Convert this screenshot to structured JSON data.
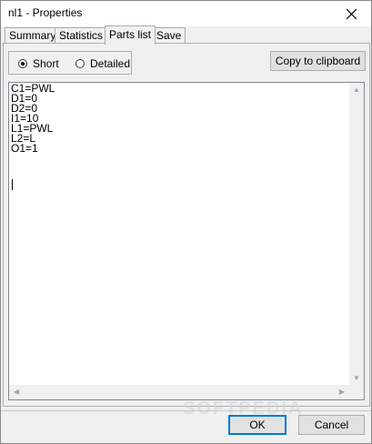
{
  "window": {
    "title": "nl1 - Properties"
  },
  "tabs": [
    {
      "label": "Summary"
    },
    {
      "label": "Statistics"
    },
    {
      "label": "Parts list"
    },
    {
      "label": "Save"
    }
  ],
  "active_tab": "Parts list",
  "options": {
    "short_label": "Short",
    "detailed_label": "Detailed",
    "selected": "Short"
  },
  "copy_button_label": "Copy to clipboard",
  "parts_list_text": "C1=PWL\nD1=0\nD2=0\nI1=10\nL1=PWL\nL2=L\nO1=1",
  "buttons": {
    "ok": "OK",
    "cancel": "Cancel"
  },
  "watermark": "SOFTPEDIA"
}
